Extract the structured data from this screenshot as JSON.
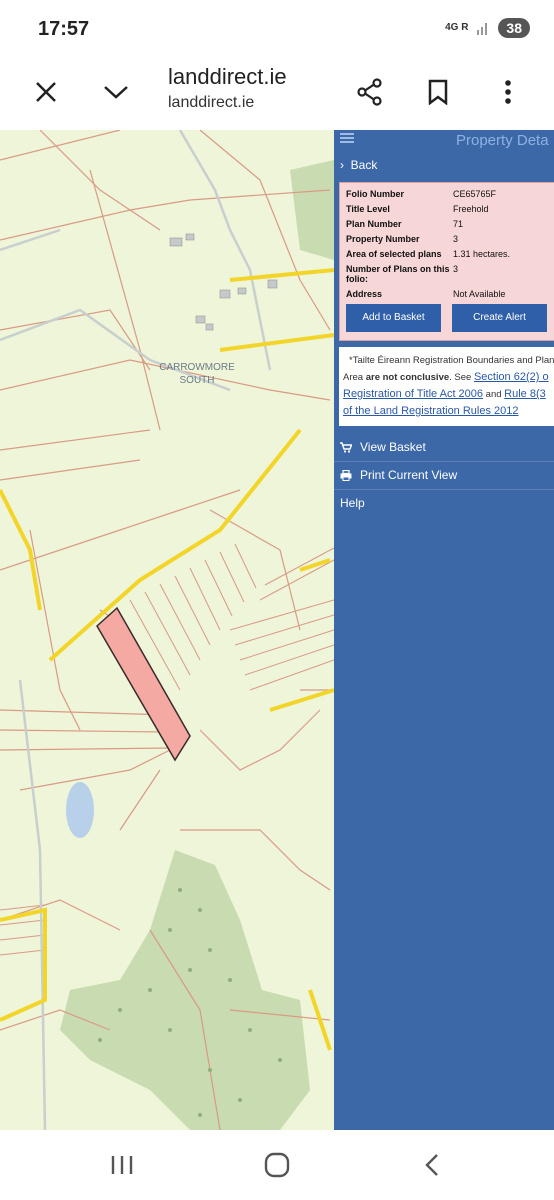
{
  "status_bar": {
    "time": "17:57",
    "network": "4G",
    "network_sub": "R",
    "battery": "38"
  },
  "browser": {
    "title": "landdirect.ie",
    "url": "landdirect.ie"
  },
  "map": {
    "place_label_line1": "CARROWMORE",
    "place_label_line2": "SOUTH"
  },
  "panel": {
    "title": "Property Deta",
    "back_label": "Back",
    "rows": [
      {
        "label": "Folio Number",
        "value": "CE65765F"
      },
      {
        "label": "Title Level",
        "value": "Freehold"
      },
      {
        "label": "Plan Number",
        "value": "71"
      },
      {
        "label": "Property Number",
        "value": "3"
      },
      {
        "label": "Area of selected plans",
        "value": "1.31 hectares."
      },
      {
        "label": "Number of Plans on this folio:",
        "value": "3"
      },
      {
        "label": "Address",
        "value": "Not Available"
      }
    ],
    "add_basket_label": "Add to Basket",
    "create_alert_label": "Create Alert",
    "note": {
      "line1": "*Tailte Éireann Registration Boundaries and Plan",
      "line2_a": "Area ",
      "line2_bold": "are not conclusive",
      "line2_b": ". See ",
      "link1": "Section 62(2) o",
      "link2": "Registration of Title Act 2006",
      "line3_mid": " and ",
      "link3": "Rule 8(3",
      "link4": "of the Land Registration Rules 2012"
    },
    "menu": {
      "view_basket": "View Basket",
      "print_view": "Print Current View",
      "help": "Help"
    }
  }
}
